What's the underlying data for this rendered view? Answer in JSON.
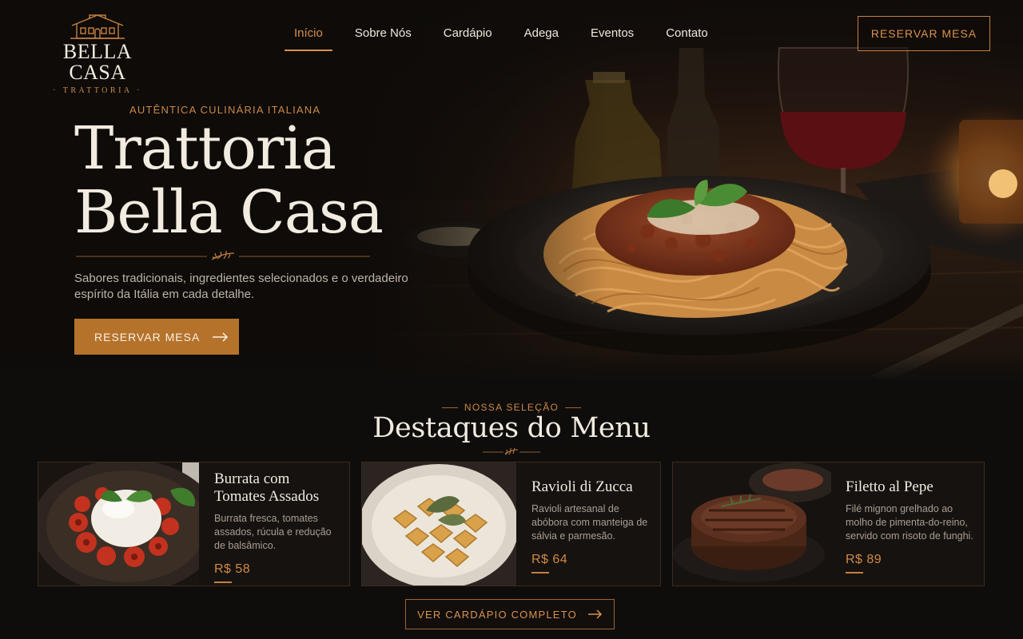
{
  "brand": {
    "name": "BELLA CASA",
    "subtitle": "· TRATTORIA ·"
  },
  "nav": {
    "items": [
      {
        "label": "Início",
        "active": true
      },
      {
        "label": "Sobre Nós",
        "active": false
      },
      {
        "label": "Cardápio",
        "active": false
      },
      {
        "label": "Adega",
        "active": false
      },
      {
        "label": "Eventos",
        "active": false
      },
      {
        "label": "Contato",
        "active": false
      }
    ],
    "cta_label": "RESERVAR MESA"
  },
  "hero": {
    "eyebrow": "AUTÊNTICA CULINÁRIA ITALIANA",
    "title_line1": "Trattoria",
    "title_line2": "Bella Casa",
    "description": "Sabores tradicionais, ingredientes selecionados e o verdadeiro espírito da Itália em cada detalhe.",
    "cta_label": "RESERVAR MESA"
  },
  "featured": {
    "eyebrow": "NOSSA SELEÇÃO",
    "title": "Destaques do Menu",
    "cards": [
      {
        "name": "Burrata com Tomates Assados",
        "description": "Burrata fresca, tomates assados, rúcula e redução de balsâmico.",
        "price": "R$ 58"
      },
      {
        "name": "Ravioli di Zucca",
        "description": "Ravioli artesanal de abóbora com manteiga de sálvia e parmesão.",
        "price": "R$ 64"
      },
      {
        "name": "Filetto al Pepe",
        "description": "Filé mignon grelhado ao molho de pimenta-do-reino, servido com risoto de funghi.",
        "price": "R$ 89"
      }
    ],
    "cta_label": "VER CARDÁPIO COMPLETO"
  },
  "colors": {
    "accent": "#c4803f",
    "primary_button": "#b5722b",
    "background": "#0f0d0b",
    "text_light": "#f1ebe0"
  },
  "icons": [
    "house-logo-icon",
    "arrow-right-icon",
    "leaf-ornament-icon"
  ]
}
